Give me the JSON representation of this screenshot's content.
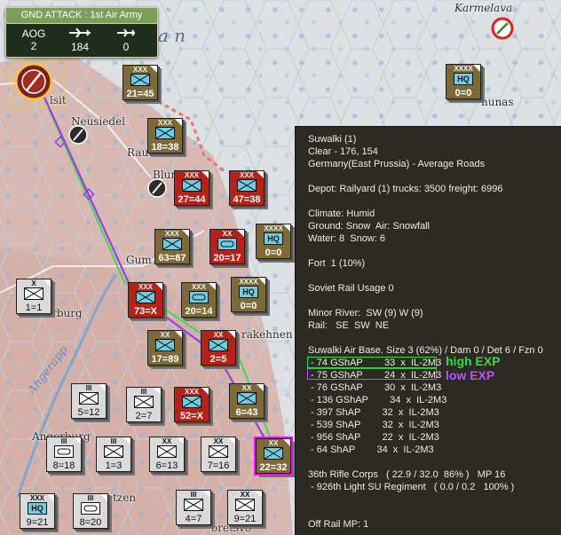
{
  "mission": {
    "title": "GND ATTACK : 1st Air Army",
    "stats": [
      {
        "label": "AOG",
        "value": "2",
        "icon": "label"
      },
      {
        "label": "",
        "value": "184",
        "icon": "aircraft-icon"
      },
      {
        "label": "",
        "value": "0",
        "icon": "aircraft-icon"
      }
    ]
  },
  "map_labels": {
    "towns": [
      "Karmelava",
      "Neusiedel",
      "Raut",
      "Blum",
      "Gum",
      "Rau",
      "lsit",
      "nunas",
      "sterburg",
      "rakehnen",
      "Angerburg",
      "etzen",
      "oretsvo"
    ],
    "river": "Angerapp",
    "region": "a n"
  },
  "counters": [
    {
      "id": "c1",
      "side": "german",
      "size": "XXXX",
      "kind": "hq",
      "value": "0=0"
    },
    {
      "id": "c2",
      "side": "german",
      "size": "XXX",
      "kind": "inf",
      "value": "21=45"
    },
    {
      "id": "c3",
      "side": "german",
      "size": "XXX",
      "kind": "inf",
      "value": "18=38"
    },
    {
      "id": "c4",
      "side": "soviet",
      "size": "XXX",
      "kind": "inf",
      "value": "27=44"
    },
    {
      "id": "c5",
      "side": "soviet",
      "size": "XXX",
      "kind": "inf",
      "value": "47=38"
    },
    {
      "id": "c6",
      "side": "german",
      "size": "XXX",
      "kind": "inf",
      "value": "63=87"
    },
    {
      "id": "c7",
      "side": "soviet",
      "size": "XX",
      "kind": "arm",
      "value": "20=17"
    },
    {
      "id": "c8",
      "side": "german",
      "size": "XXXX",
      "kind": "hq",
      "value": "0=0"
    },
    {
      "id": "c9",
      "side": "soviet",
      "size": "XXX",
      "kind": "inf",
      "value": "73=X"
    },
    {
      "id": "c10",
      "side": "german",
      "size": "XXX",
      "kind": "arm",
      "value": "20=14"
    },
    {
      "id": "c11",
      "side": "german",
      "size": "XXXX",
      "kind": "hq",
      "value": "0=0"
    },
    {
      "id": "c12",
      "side": "grey",
      "size": "X",
      "kind": "inf",
      "value": "1=1"
    },
    {
      "id": "c13",
      "side": "german",
      "size": "XX",
      "kind": "inf",
      "value": "17=89"
    },
    {
      "id": "c14",
      "side": "soviet",
      "size": "XX",
      "kind": "inf",
      "value": "2=5"
    },
    {
      "id": "c15",
      "side": "grey",
      "size": "III",
      "kind": "inf",
      "value": "5=12"
    },
    {
      "id": "c16",
      "side": "grey",
      "size": "III",
      "kind": "inf",
      "value": "2=7"
    },
    {
      "id": "c17",
      "side": "soviet",
      "size": "XXX",
      "kind": "inf",
      "value": "52=X"
    },
    {
      "id": "c18",
      "side": "german",
      "size": "XX",
      "kind": "inf",
      "value": "6=43"
    },
    {
      "id": "c19",
      "side": "grey",
      "size": "III",
      "kind": "arm",
      "value": "8=18"
    },
    {
      "id": "c20",
      "side": "grey",
      "size": "III",
      "kind": "inf",
      "value": "1=3"
    },
    {
      "id": "c21",
      "side": "grey",
      "size": "XX",
      "kind": "inf",
      "value": "6=13"
    },
    {
      "id": "c22",
      "side": "grey",
      "size": "XX",
      "kind": "inf",
      "value": "7=16"
    },
    {
      "id": "c23",
      "side": "german",
      "size": "XX",
      "kind": "inf",
      "value": "22=32"
    },
    {
      "id": "c24",
      "side": "grey",
      "size": "XXX",
      "kind": "hq",
      "value": "9=21"
    },
    {
      "id": "c25",
      "side": "grey",
      "size": "III",
      "kind": "arm",
      "value": "8=20"
    },
    {
      "id": "c26",
      "side": "grey",
      "size": "III",
      "kind": "inf",
      "value": "4=7"
    },
    {
      "id": "c27",
      "side": "grey",
      "size": "XX",
      "kind": "inf",
      "value": "9=21"
    }
  ],
  "info": {
    "lines": [
      "Suwalki (1)",
      "Clear - 176, 154",
      "Germany(East Prussia) - Average Roads",
      "",
      "Depot: Railyard (1) trucks: 3500 freight: 6996",
      "",
      "Climate: Humid",
      "Ground: Snow  Air: Snowfall",
      "Water: 8  Snow: 6",
      "",
      "Fort  1 (10%)",
      "",
      "Soviet Rail Usage 0",
      "",
      "Minor River:  SW (9) W (9)",
      "Rail:   SE  SW  NE",
      "",
      "Suwalki Air Base. Size 3 (62%) / Dam 0 / Det 6 / Fzn 0",
      " - 74 GShAP        33  x  IL-2M3",
      " - 75 GShAP        24  x  IL-2M3",
      " - 76 GShAP        30  x  IL-2M3",
      " - 136 GShAP        34  x  IL-2M3",
      " - 397 ShAP        32  x  IL-2M3",
      " - 539 ShAP        32  x  IL-2M3",
      " - 956 ShAP        22  x  IL-2M3",
      " - 64 ShAP        34  x  IL-2M3",
      "",
      "36th Rifle Corps   ( 22.9 / 32.0  86% )   MP 16",
      " - 926th Light SU Regiment   ( 0.0 / 0.2   100% )",
      "",
      "",
      "Off Rail MP: 1"
    ],
    "annotations": {
      "high": "high EXP",
      "low": "low EXP"
    }
  },
  "colors": {
    "high": "#2fe03a",
    "low": "#c050ff",
    "path_green": "#3ddb55",
    "path_purple": "#9a3ee0"
  }
}
